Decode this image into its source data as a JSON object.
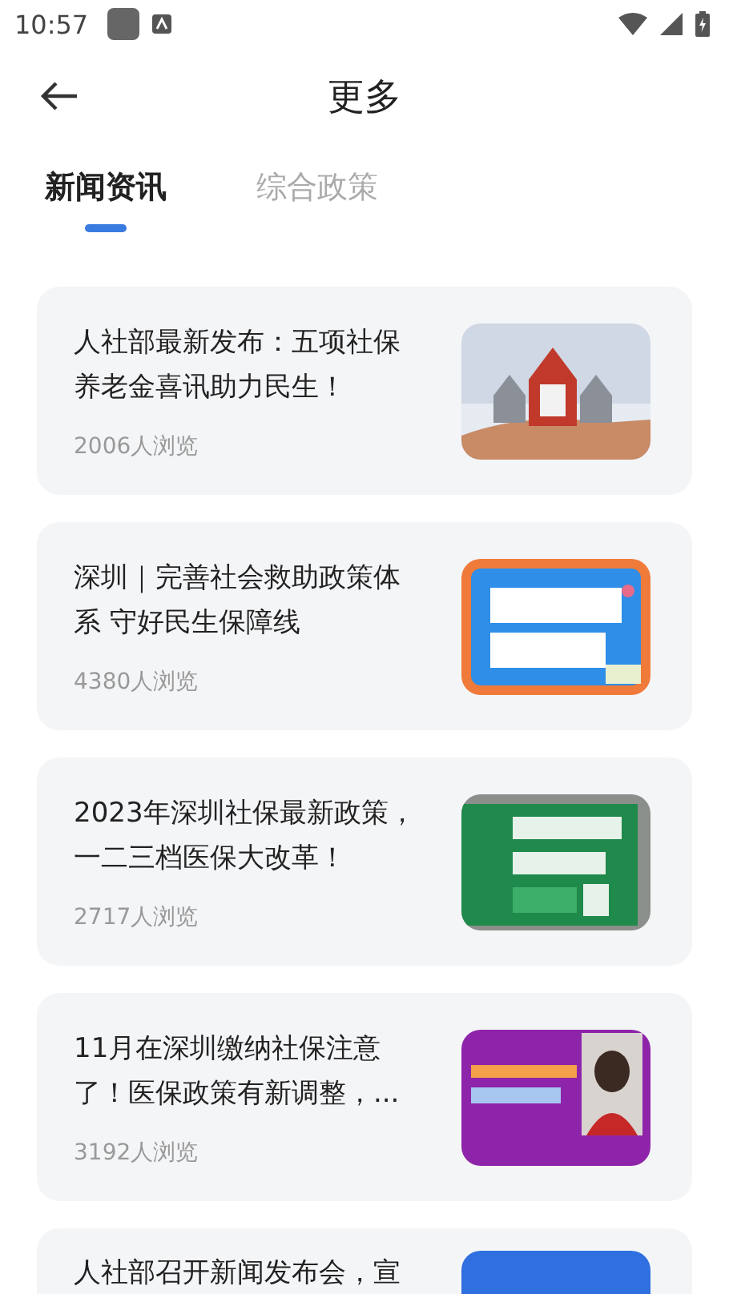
{
  "status_bar": {
    "time": "10:57"
  },
  "header": {
    "title": "更多"
  },
  "tabs": [
    {
      "label": "新闻资讯",
      "selected": true
    },
    {
      "label": "综合政策",
      "selected": false
    }
  ],
  "articles": [
    {
      "title": "人社部最新发布：五项社保养老金喜讯助力民生！",
      "views": "2006人浏览"
    },
    {
      "title": "深圳｜完善社会救助政策体系 守好民生保障线",
      "views": "4380人浏览"
    },
    {
      "title": "2023年深圳社保最新政策，一二三档医保大改革！",
      "views": "2717人浏览"
    },
    {
      "title": "11月在深圳缴纳社保注意了！医保政策有新调整，...",
      "views": "3192人浏览"
    },
    {
      "title": "人社部召开新闻发布会，宣"
    }
  ]
}
